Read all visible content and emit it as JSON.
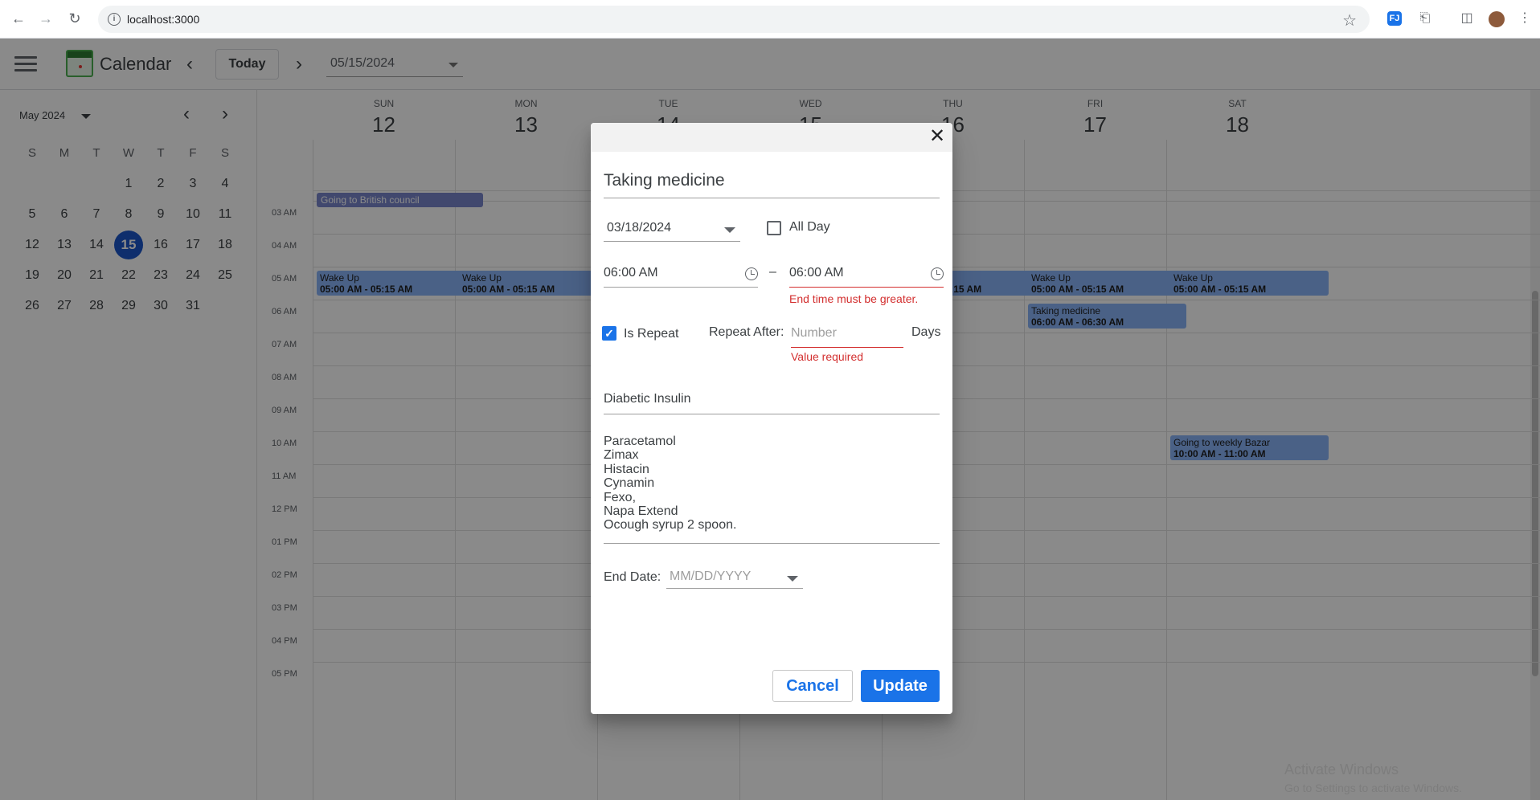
{
  "browser": {
    "url": "localhost:3000",
    "back_icon": "arrow-left-icon",
    "forward_icon": "arrow-right-icon",
    "reload_icon": "reload-icon"
  },
  "header": {
    "title": "Calendar",
    "today_label": "Today",
    "date_value": "05/15/2024"
  },
  "sidebar": {
    "month_label": "May 2024",
    "weekday_initials": [
      "S",
      "M",
      "T",
      "W",
      "T",
      "F",
      "S"
    ],
    "weeks": [
      [
        "",
        "",
        "",
        "1",
        "2",
        "3",
        "4"
      ],
      [
        "5",
        "6",
        "7",
        "8",
        "9",
        "10",
        "11"
      ],
      [
        "12",
        "13",
        "14",
        "15",
        "16",
        "17",
        "18"
      ],
      [
        "19",
        "20",
        "21",
        "22",
        "23",
        "24",
        "25"
      ],
      [
        "26",
        "27",
        "28",
        "29",
        "30",
        "31",
        ""
      ]
    ],
    "selected_day": "15"
  },
  "week": {
    "days": [
      {
        "dow": "SUN",
        "num": "12"
      },
      {
        "dow": "MON",
        "num": "13"
      },
      {
        "dow": "TUE",
        "num": "14"
      },
      {
        "dow": "WED",
        "num": "15"
      },
      {
        "dow": "THU",
        "num": "16"
      },
      {
        "dow": "FRI",
        "num": "17"
      },
      {
        "dow": "SAT",
        "num": "18"
      }
    ],
    "hours": [
      "03 AM",
      "04 AM",
      "05 AM",
      "06 AM",
      "07 AM",
      "08 AM",
      "09 AM",
      "10 AM",
      "11 AM",
      "12 PM",
      "01 PM",
      "02 PM",
      "03 PM",
      "04 PM",
      "05 PM"
    ],
    "allday_events": [
      {
        "title": "Going to British council"
      }
    ],
    "events": [
      {
        "title": "Wake Up",
        "time": "05:00 AM - 05:15 AM"
      },
      {
        "title": "Wake Up",
        "time": "05:00 AM - 05:15 AM"
      },
      {
        "title": "Wake Up",
        "time": "05:00 AM - 05:15 AM"
      },
      {
        "title": "Wake Up",
        "time": "05:00 AM - 05:15 AM"
      },
      {
        "title": "Wake Up",
        "time": "05:00 AM - 05:15 AM"
      },
      {
        "title": "Taking medicine",
        "time": "06:00 AM - 06:30 AM"
      },
      {
        "title": "Going to weekly Bazar",
        "time": "10:00 AM - 11:00 AM"
      }
    ]
  },
  "watermark": {
    "line1": "Activate Windows",
    "line2": "Go to Settings to activate Windows."
  },
  "dialog": {
    "title_value": "Taking medicine",
    "date_value": "03/18/2024",
    "all_day_label": "All Day",
    "all_day_checked": false,
    "start_time": "06:00 AM",
    "separator": "–",
    "end_time": "06:00 AM",
    "end_time_error": "End time must be greater.",
    "is_repeat_label": "Is Repeat",
    "is_repeat_checked": true,
    "repeat_after_label": "Repeat After:",
    "repeat_placeholder": "Number",
    "repeat_unit": "Days",
    "repeat_error": "Value required",
    "description_value": "Diabetic Insulin",
    "notes_value": "Paracetamol\nZimax\nHistacin\nCynamin\nFexo,\nNapa Extend\nOcough syrup 2 spoon.",
    "end_date_label": "End Date:",
    "end_date_placeholder": "MM/DD/YYYY",
    "cancel_label": "Cancel",
    "update_label": "Update"
  }
}
